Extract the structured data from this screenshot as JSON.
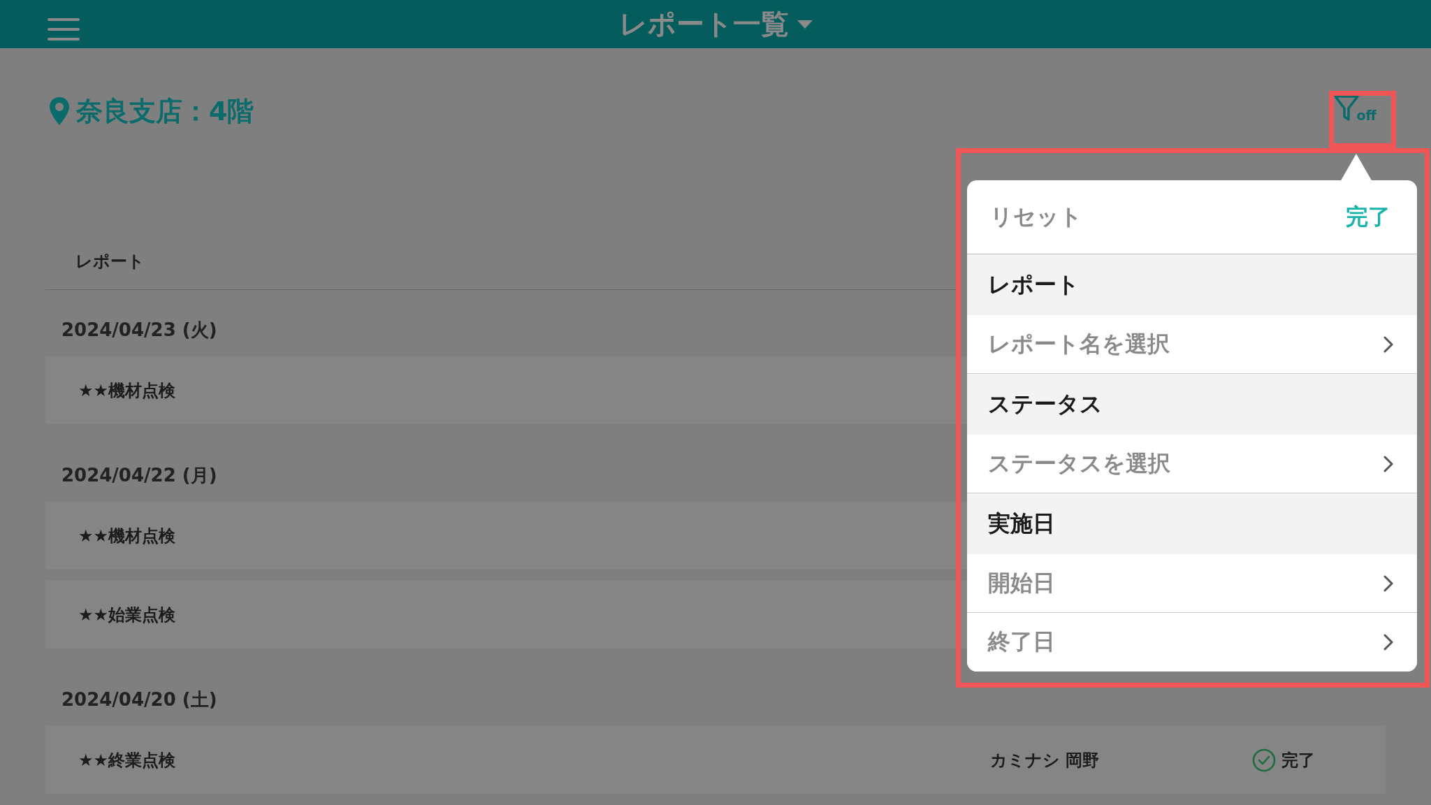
{
  "header": {
    "title": "レポート一覧"
  },
  "location": "奈良支店：4階",
  "filter": {
    "label": "off"
  },
  "table": {
    "column": "レポート",
    "groups": [
      {
        "date": "2024/04/23 (火)",
        "rows": [
          {
            "name": "★★機材点検"
          }
        ]
      },
      {
        "date": "2024/04/22 (月)",
        "rows": [
          {
            "name": "★★機材点検"
          },
          {
            "name": "★★始業点検"
          }
        ]
      },
      {
        "date": "2024/04/20 (土)",
        "rows": [
          {
            "name": "★★終業点検",
            "assignee": "カミナシ 岡野",
            "status": "完了"
          }
        ]
      }
    ]
  },
  "popover": {
    "reset": "リセット",
    "done": "完了",
    "sections": [
      {
        "title": "レポート",
        "options": [
          "レポート名を選択"
        ]
      },
      {
        "title": "ステータス",
        "options": [
          "ステータスを選択"
        ]
      },
      {
        "title": "実施日",
        "options": [
          "開始日",
          "終了日"
        ]
      }
    ]
  }
}
